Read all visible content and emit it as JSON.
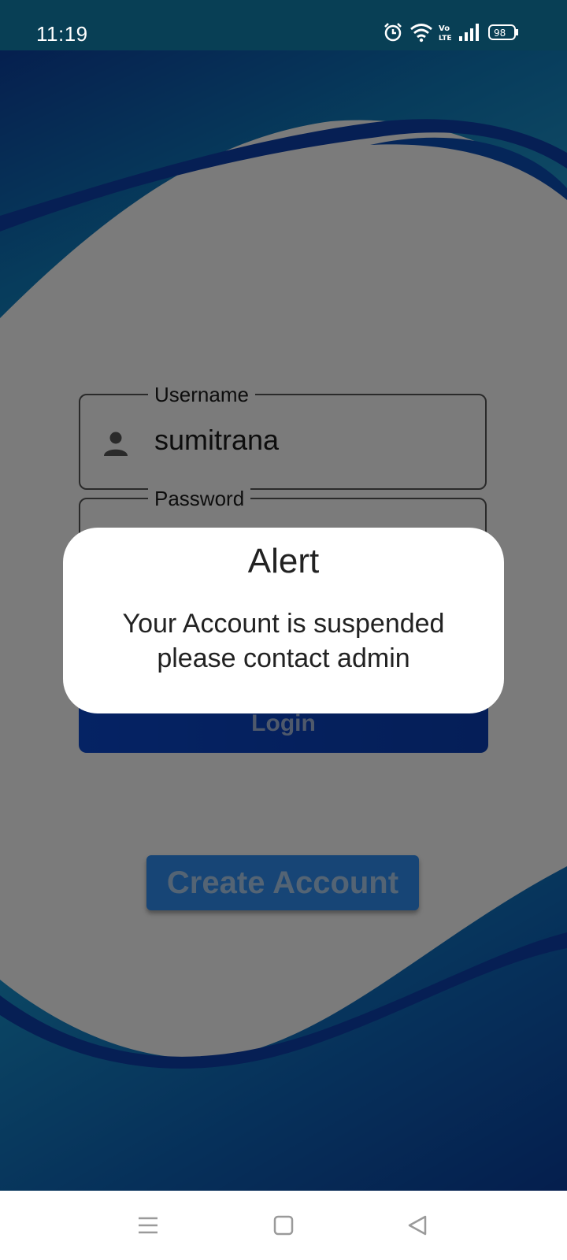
{
  "status_bar": {
    "time": "11:19",
    "battery": "98"
  },
  "login": {
    "username_label": "Username",
    "username_value": "sumitrana",
    "password_label": "Password",
    "login_button": "Login",
    "create_account_button": "Create Account"
  },
  "dialog": {
    "title": "Alert",
    "message_line1": "Your Account is suspended",
    "message_line2": "please contact admin"
  },
  "icons": {
    "alarm": "alarm-icon",
    "wifi": "wifi-icon",
    "volte": "volte-icon",
    "signal": "signal-icon",
    "battery": "battery-icon",
    "person": "person-icon",
    "menu": "menu-icon",
    "home": "home-icon",
    "back": "back-icon"
  },
  "colors": {
    "wave_blue": "#0a4a8e",
    "login_button": "#0b46c8",
    "create_button": "#2f8bec",
    "dialog_bg": "#ffffff"
  }
}
